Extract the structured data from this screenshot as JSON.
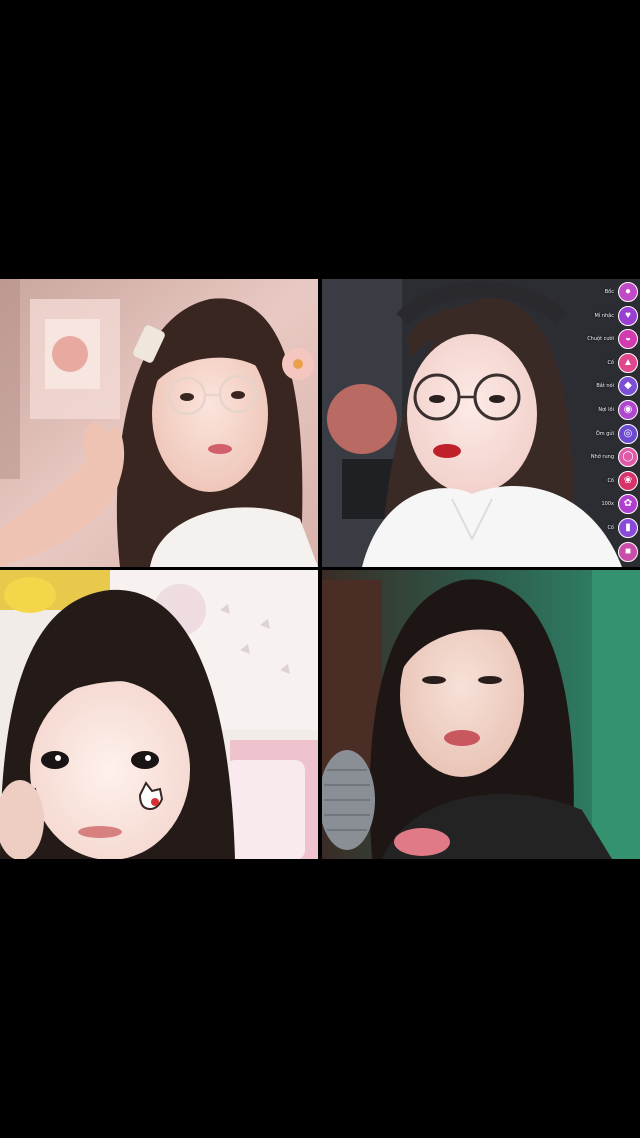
{
  "layout_name": "live-multi-guest",
  "tiles": [
    {
      "id": "guest-1",
      "description": "girl with hair clip and glasses"
    },
    {
      "id": "guest-2",
      "description": "girl with glasses and headband"
    },
    {
      "id": "guest-3",
      "description": "girl with cat face stickers"
    },
    {
      "id": "guest-4",
      "description": "girl with microphone"
    }
  ],
  "gift_menu": {
    "items": [
      {
        "label": "Bốc",
        "icon": "bear-gift-icon",
        "color": "#c04ac8"
      },
      {
        "label": "Mỉ nhậc",
        "icon": "heart-gift-icon",
        "color": "#9b3fd1"
      },
      {
        "label": "Chuột cười",
        "icon": "lips-gift-icon",
        "color": "#d23ab0"
      },
      {
        "label": "Cố",
        "icon": "cake-gift-icon",
        "color": "#e0478c"
      },
      {
        "label": "Bắt nói",
        "icon": "dog-gift-icon",
        "color": "#7d4fd6"
      },
      {
        "label": "Nợi lồi",
        "icon": "puppy-gift-icon",
        "color": "#b146cf"
      },
      {
        "label": "Ôm gửi",
        "icon": "panda-gift-icon",
        "color": "#6c4bd0"
      },
      {
        "label": "Nhớ rung",
        "icon": "donut-gift-icon",
        "color": "#e05aa8"
      },
      {
        "label": "Cố",
        "icon": "rose-gift-icon",
        "color": "#d6336b"
      },
      {
        "label": "100x",
        "icon": "bouquet-gift-icon",
        "color": "#b03fd0"
      },
      {
        "label": "Cố",
        "icon": "bottle-gift-icon",
        "color": "#8a4ad8"
      },
      {
        "label": "",
        "icon": "gift-box-icon",
        "color": "#c84ca8"
      }
    ]
  }
}
